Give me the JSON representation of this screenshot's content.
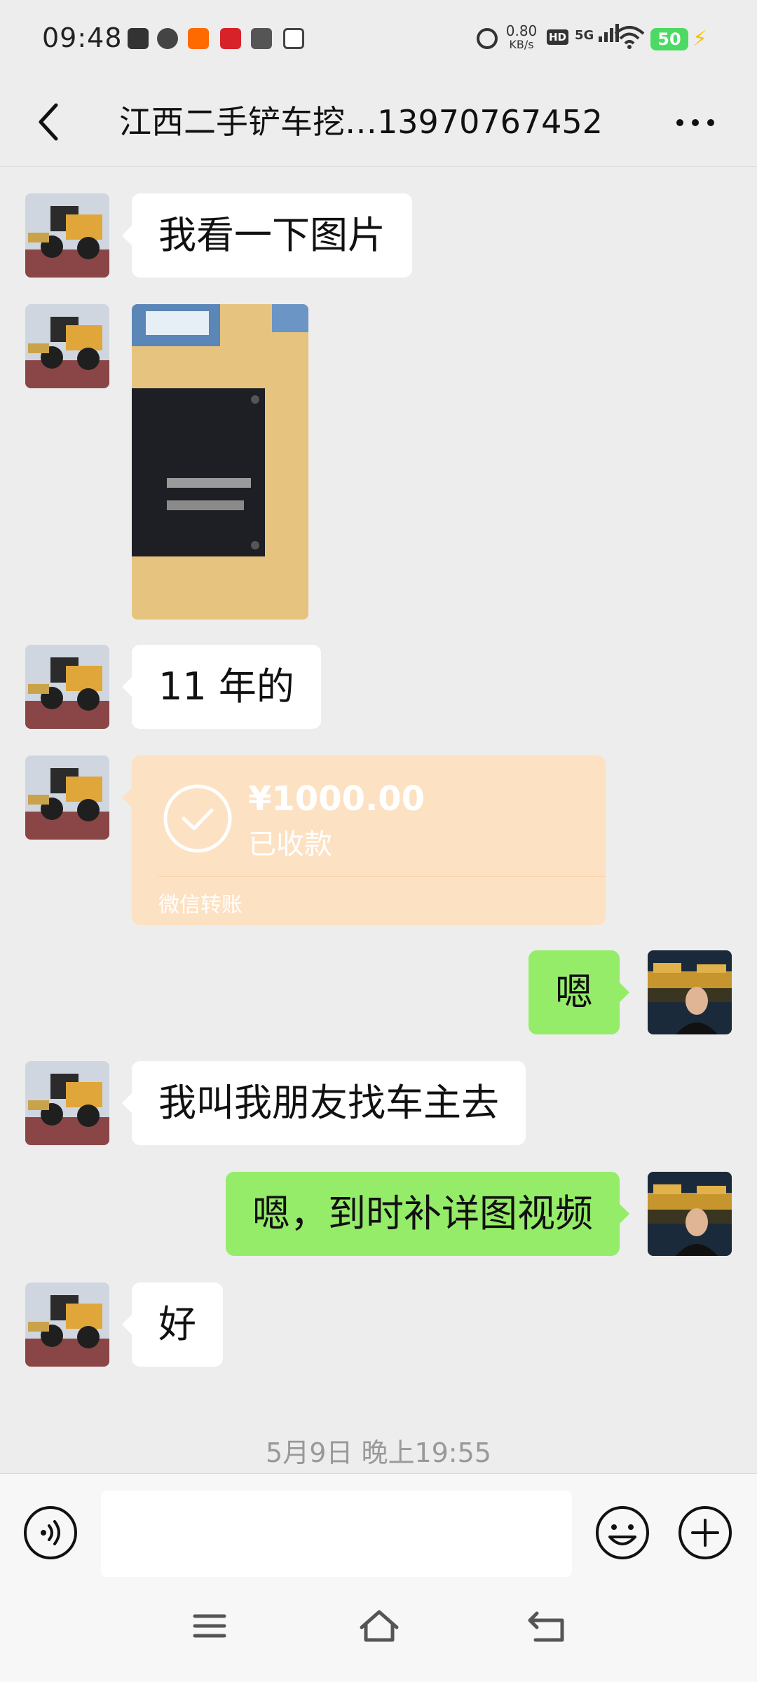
{
  "status_bar": {
    "time": "09:48",
    "net_speed_value": "0.80",
    "net_speed_unit": "KB/s",
    "hd_label": "HD",
    "network": "5G",
    "battery": "50",
    "app_icons": [
      "k-app-icon",
      "leaf-app-icon",
      "kuaishou-icon",
      "music-app-icon",
      "telegram-icon",
      "iqiyi-icon"
    ]
  },
  "header": {
    "title": "江西二手铲车挖…13970767452"
  },
  "messages": [
    {
      "side": "in",
      "type": "text",
      "text": "我看一下图片"
    },
    {
      "side": "in",
      "type": "image"
    },
    {
      "side": "in",
      "type": "text",
      "text": "11 年的"
    },
    {
      "side": "in",
      "type": "transfer",
      "amount": "¥1000.00",
      "status": "已收款",
      "brand": "微信转账"
    },
    {
      "side": "out",
      "type": "text",
      "text": "嗯"
    },
    {
      "side": "in",
      "type": "text",
      "text": "我叫我朋友找车主去"
    },
    {
      "side": "out",
      "type": "text",
      "text": "嗯，到时补详图视频"
    },
    {
      "side": "in",
      "type": "text",
      "text": "好"
    }
  ],
  "timestamp": "5月9日 晚上19:55",
  "colors": {
    "background": "#ededed",
    "incoming_bubble": "#ffffff",
    "outgoing_bubble": "#95ec69",
    "transfer_received": "#fde1c3"
  }
}
